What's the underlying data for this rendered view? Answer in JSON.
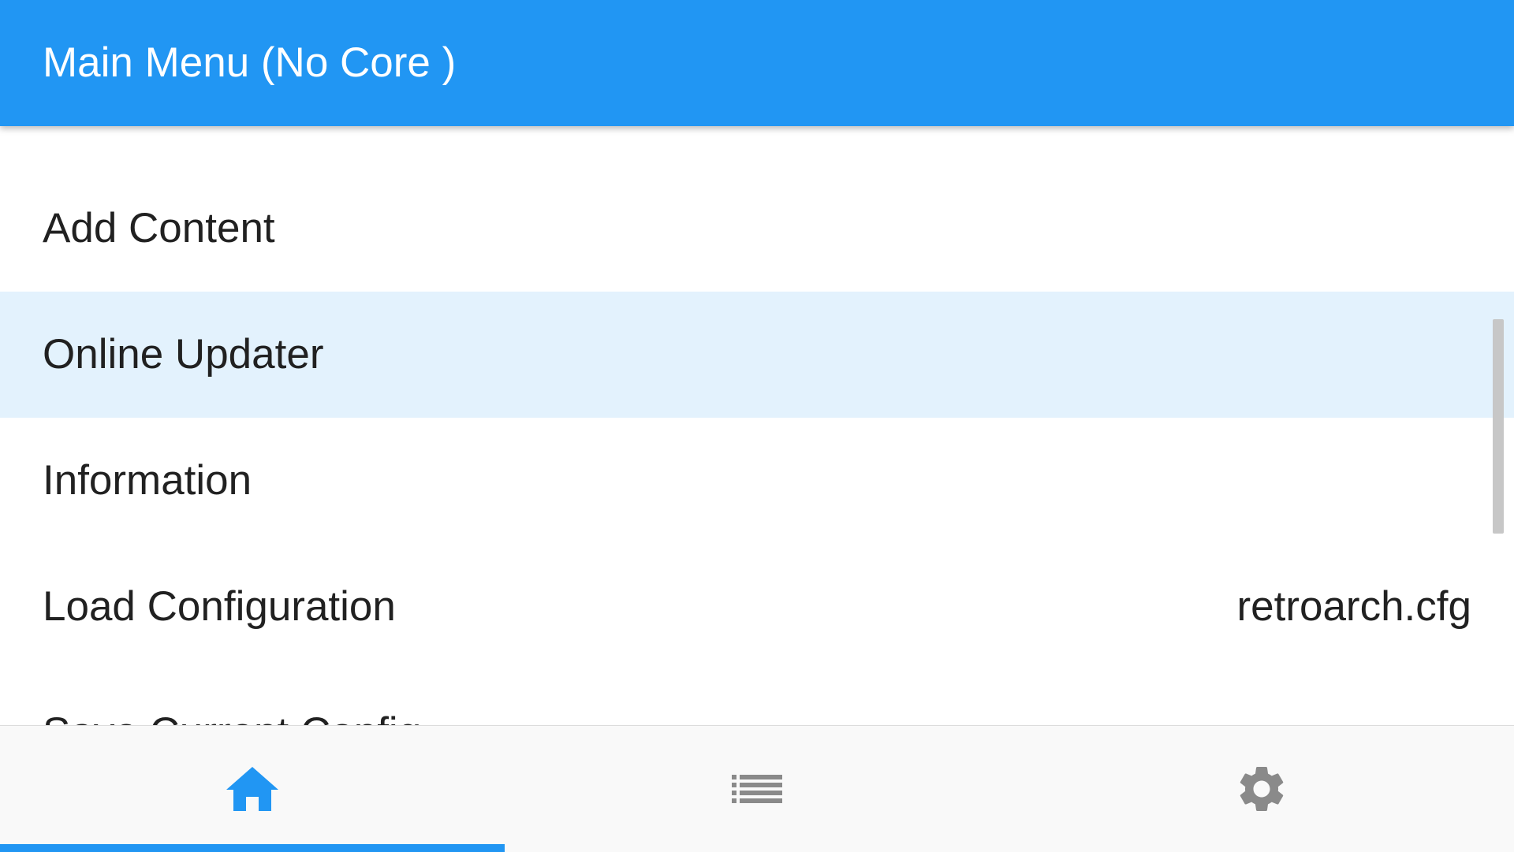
{
  "header": {
    "title": "Main Menu (No Core )"
  },
  "menu": {
    "items": [
      {
        "label": "Add Content",
        "value": ""
      },
      {
        "label": "Online Updater",
        "value": ""
      },
      {
        "label": "Information",
        "value": ""
      },
      {
        "label": "Load Configuration",
        "value": "retroarch.cfg"
      },
      {
        "label": "Save Current Config",
        "value": ""
      }
    ],
    "selected_index": 1
  },
  "tabs": [
    {
      "icon": "home-icon",
      "active": true
    },
    {
      "icon": "list-icon",
      "active": false
    },
    {
      "icon": "gear-icon",
      "active": false
    }
  ],
  "colors": {
    "accent": "#2196f3",
    "selected_row": "#e3f2fd",
    "inactive_icon": "#8a8a8a",
    "text": "#212121"
  }
}
